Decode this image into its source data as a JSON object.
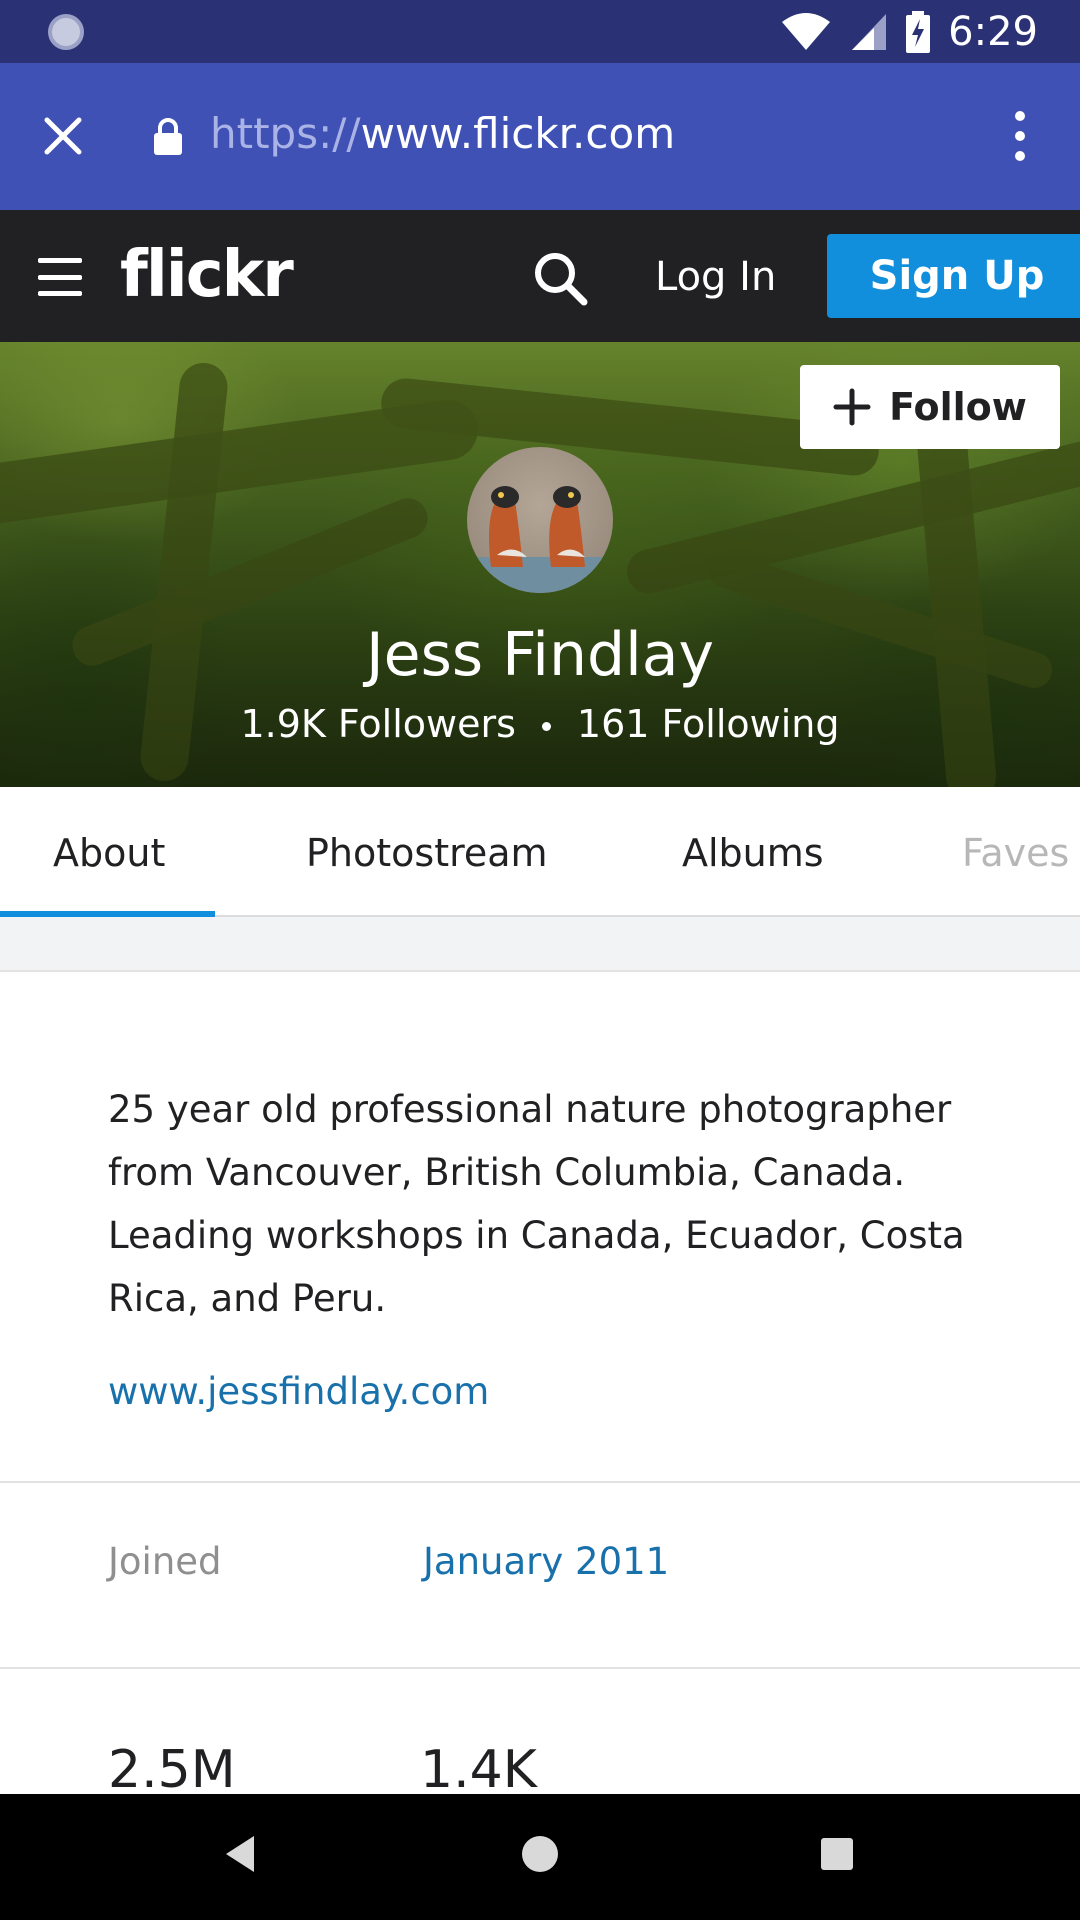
{
  "status_bar": {
    "time": "6:29",
    "icons": [
      "sync-icon",
      "wifi-icon",
      "signal-icon",
      "battery-charging-icon"
    ]
  },
  "browser": {
    "url_protocol": "https://",
    "url_host": "www.flickr.com",
    "icons": [
      "close-icon",
      "lock-icon",
      "more-vert-icon"
    ]
  },
  "header": {
    "logo": "flickr",
    "login_label": "Log In",
    "signup_label": "Sign Up",
    "accent": "#128fdc"
  },
  "profile": {
    "follow_label": "Follow",
    "name": "Jess Findlay",
    "followers": "1.9K Followers",
    "following": "161 Following"
  },
  "tabs": [
    {
      "label": "About",
      "active": true
    },
    {
      "label": "Photostream"
    },
    {
      "label": "Albums"
    },
    {
      "label": "Faves"
    }
  ],
  "about": {
    "bio": "25 year old professional nature photographer from Vancouver, British Columbia, Canada. Leading workshops in Canada, Ecuador, Costa Rica, and Peru.",
    "website": "www.jessfindlay.com",
    "joined_label": "Joined",
    "joined_value": "January 2011",
    "counts": [
      "2.5M",
      "1.4K"
    ]
  },
  "nav": {
    "icons": [
      "back-icon",
      "home-icon",
      "recents-icon"
    ]
  },
  "colors": {
    "status_bar": "#2b3175",
    "browser_bar": "#3f51b5",
    "header_bg": "#212124",
    "link": "#1971ab"
  }
}
